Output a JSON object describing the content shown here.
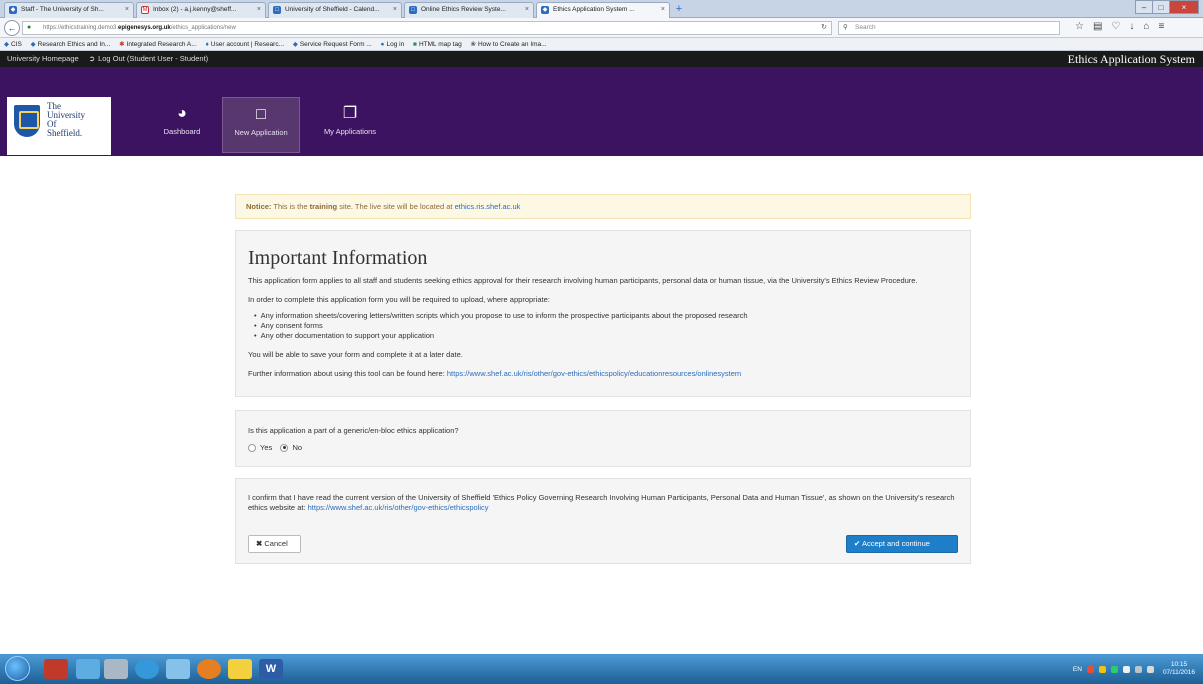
{
  "browser": {
    "tabs": [
      {
        "label": "Staff - The University of Sh..."
      },
      {
        "label": "Inbox (2) - a.j.kenny@sheff..."
      },
      {
        "label": "University of Sheffield - Calend..."
      },
      {
        "label": "Online Ethics Review Syste..."
      },
      {
        "label": "Ethics Application System ..."
      }
    ],
    "url_prefix": "https://ethicstraining.demo3.",
    "url_domain": "epigenesys.org.uk",
    "url_path": "/ethics_applications/new",
    "search_placeholder": "Search",
    "bookmarks": [
      "CIS",
      "Research Ethics and In...",
      "Integrated Research A...",
      "User account | Researc...",
      "Service Request Form ...",
      "Log in",
      "HTML map tag",
      "How to Create an Ima..."
    ]
  },
  "site": {
    "topbar": {
      "home_link": "University Homepage",
      "logout_link": "Log Out (Student User - Student)",
      "system_name": "Ethics Application System"
    },
    "logo": {
      "line1": "The",
      "line2": "University",
      "line3": "Of",
      "line4": "Sheffield."
    },
    "nav": [
      {
        "label": "Dashboard"
      },
      {
        "label": "New Application"
      },
      {
        "label": "My Applications"
      }
    ]
  },
  "notice": {
    "prefix": "Notice:",
    "text_before": " This is the ",
    "bold": "training",
    "text_after": " site. The live site will be located at ",
    "link": "ethics.ris.shef.ac.uk"
  },
  "info": {
    "title": "Important Information",
    "para1": "This application form applies to all staff and students seeking ethics approval for their research involving human participants, personal data or human tissue, via the University's Ethics Review Procedure.",
    "para2": "In order to complete this application form you will be required to upload, where appropriate:",
    "items": [
      "Any information sheets/covering letters/written scripts which you propose to use to inform the prospective participants about the proposed research",
      "Any consent forms",
      "Any other documentation to support your application"
    ],
    "para3": "You will be able to save your form and complete it at a later date.",
    "para4": "Further information about using this tool can be found here: ",
    "para4_link": "https://www.shef.ac.uk/ris/other/gov-ethics/ethicspolicy/educationresources/onlinesystem"
  },
  "generic": {
    "question": "Is this application a part of a generic/en-bloc ethics application?",
    "yes_label": "Yes",
    "no_label": "No",
    "selected": "No"
  },
  "confirm": {
    "text": "I confirm that I have read the current version of the University of Sheffield 'Ethics Policy Governing Research Involving Human Participants, Personal Data and Human Tissue', as shown on the University's research ethics website at: ",
    "link": "https://www.shef.ac.uk/ris/other/gov-ethics/ethicspolicy",
    "cancel_label": "Cancel",
    "accept_label": "Accept and continue"
  },
  "taskbar": {
    "lang": "EN",
    "time": "10:15",
    "date": "07/11/2016"
  },
  "colors": {
    "header": "#3c1361",
    "primary_button": "#1e7ec8",
    "notice_bg": "#fcf8e3"
  }
}
